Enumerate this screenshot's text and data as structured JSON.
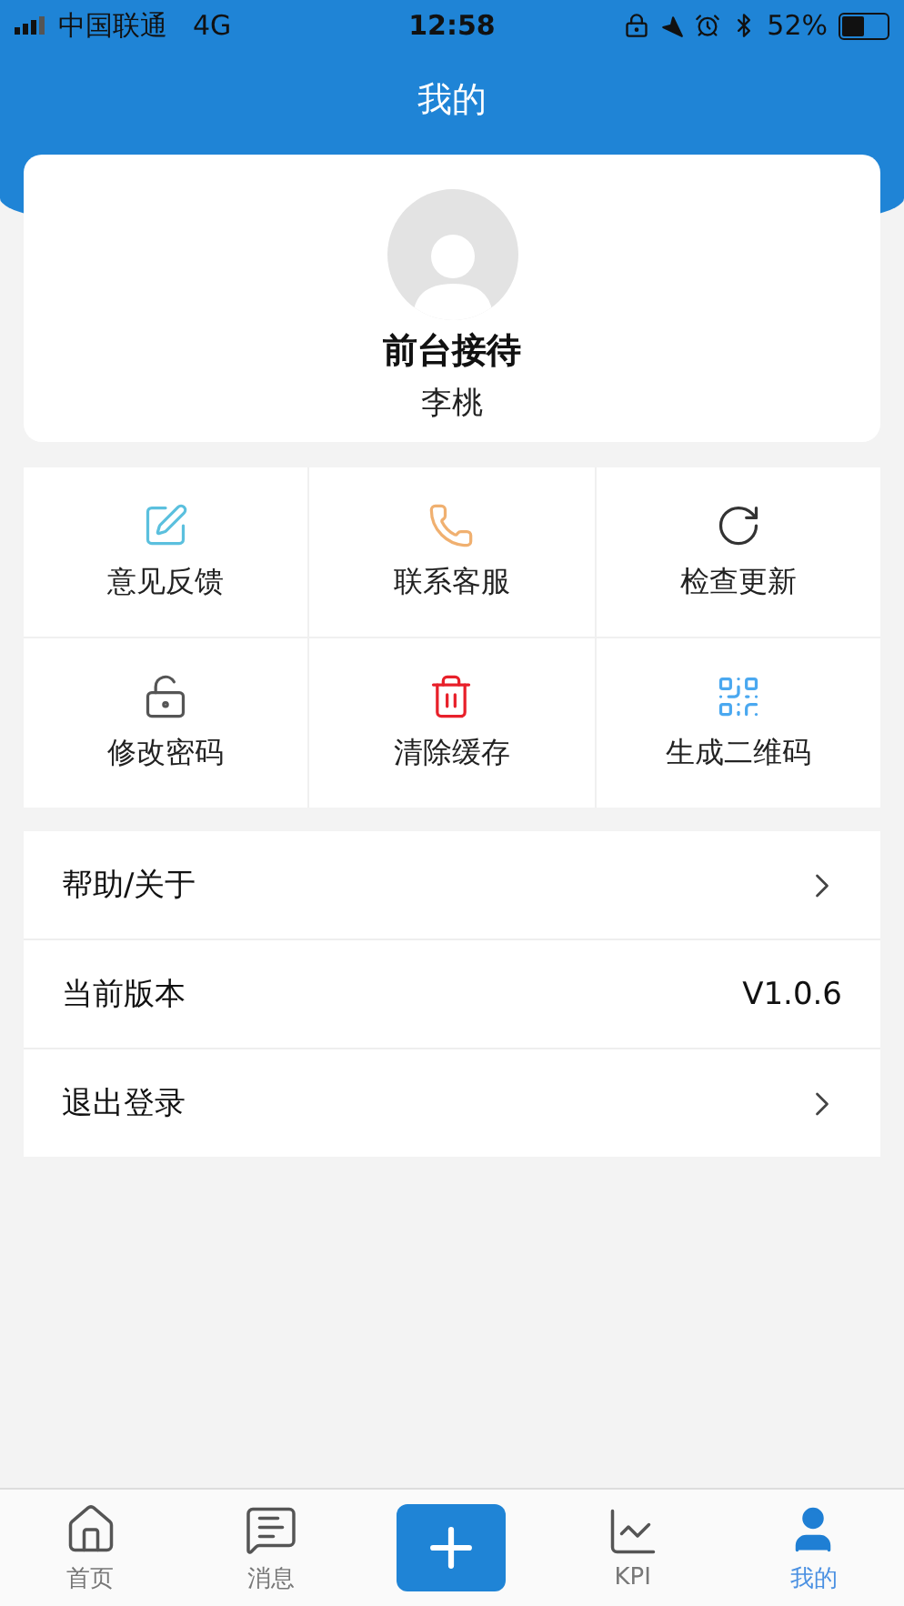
{
  "status_bar": {
    "carrier": "中国联通",
    "network": "4G",
    "time": "12:58",
    "battery": "52%"
  },
  "header": {
    "title": "我的"
  },
  "profile": {
    "role": "前台接待",
    "name": "李桃"
  },
  "actions": [
    {
      "kind": "feedback",
      "label": "意见反馈",
      "color": "#5bc0de"
    },
    {
      "kind": "phone",
      "label": "联系客服",
      "color": "#f0b070"
    },
    {
      "kind": "update",
      "label": "检查更新",
      "color": "#333333"
    },
    {
      "kind": "password",
      "label": "修改密码",
      "color": "#555555"
    },
    {
      "kind": "clear",
      "label": "清除缓存",
      "color": "#e8202a"
    },
    {
      "kind": "qrcode",
      "label": "生成二维码",
      "color": "#4aa8f0"
    }
  ],
  "menu": [
    {
      "kind": "link",
      "label": "帮助/关于"
    },
    {
      "kind": "value",
      "label": "当前版本",
      "value": "V1.0.6"
    },
    {
      "kind": "link",
      "label": "退出登录"
    }
  ],
  "tabs": [
    {
      "kind": "home",
      "label": "首页",
      "selected": false
    },
    {
      "kind": "messages",
      "label": "消息",
      "selected": false
    },
    {
      "kind": "add"
    },
    {
      "kind": "kpi",
      "label": "KPI",
      "selected": false
    },
    {
      "kind": "profile",
      "label": "我的",
      "selected": true
    }
  ]
}
